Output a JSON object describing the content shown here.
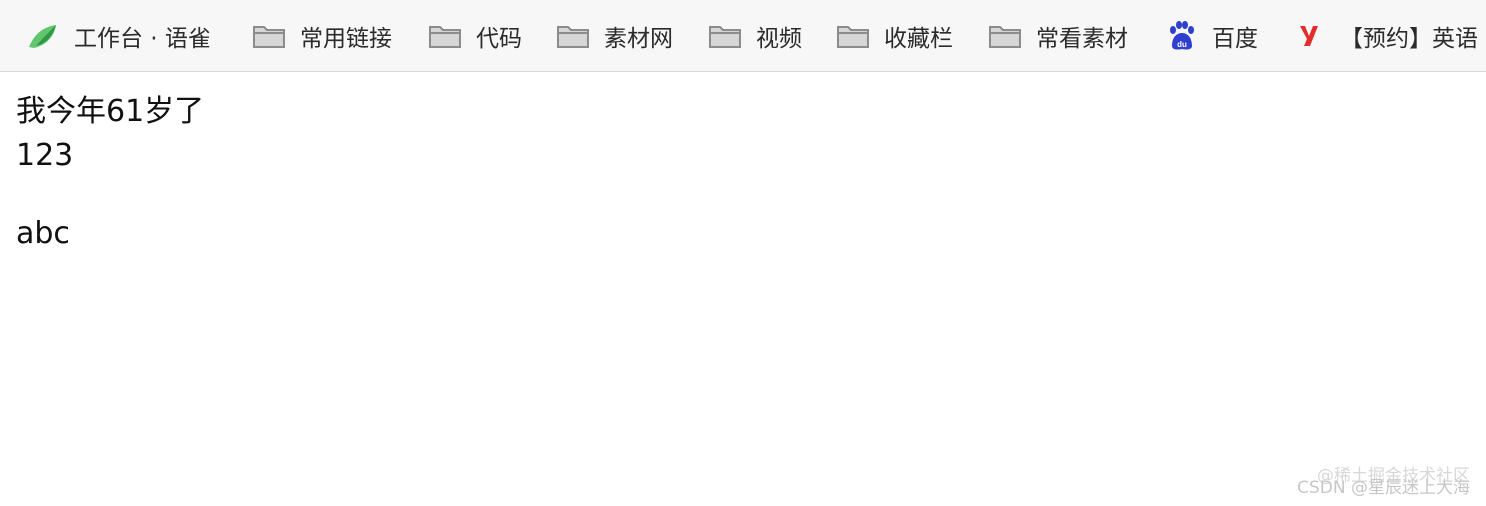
{
  "bookmarks": [
    {
      "label": "工作台 · 语雀",
      "icon": "yuque-bird-icon"
    },
    {
      "label": "常用链接",
      "icon": "folder-icon"
    },
    {
      "label": "代码",
      "icon": "folder-icon"
    },
    {
      "label": "素材网",
      "icon": "folder-icon"
    },
    {
      "label": "视频",
      "icon": "folder-icon"
    },
    {
      "label": "收藏栏",
      "icon": "folder-icon"
    },
    {
      "label": "常看素材",
      "icon": "folder-icon"
    },
    {
      "label": "百度",
      "icon": "baidu-paw-icon"
    },
    {
      "label": "【预约】英语",
      "icon": "youdao-y-icon"
    }
  ],
  "content": {
    "line1": "我今年61岁了",
    "line2": "123",
    "line3": "abc"
  },
  "watermark": {
    "csdn": "CSDN @星辰迷上大海",
    "juejin": "@稀土掘金技术社区"
  },
  "colors": {
    "yuque_green": "#3cb45a",
    "baidu_blue": "#2f3fcf",
    "youdao_red": "#e22d2d",
    "folder_gray": "#9a9a9a"
  }
}
